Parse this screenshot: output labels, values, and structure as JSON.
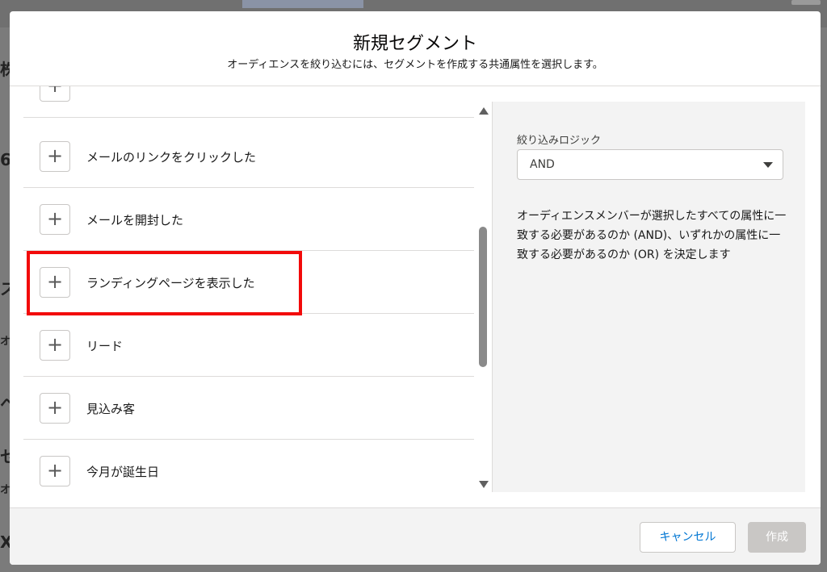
{
  "background": {
    "fragments": [
      "株",
      "6",
      "ス",
      "オ",
      "ヘ",
      "セ",
      "オ",
      "X"
    ]
  },
  "modal": {
    "title": "新規セグメント",
    "subtitle": "オーディエンスを絞り込むには、セグメントを作成する共通属性を選択します。"
  },
  "attribute_list": {
    "items": [
      {
        "label": "",
        "add_icon": "+"
      },
      {
        "label": "メールのリンクをクリックした",
        "add_icon": "+"
      },
      {
        "label": "メールを開封した",
        "add_icon": "+"
      },
      {
        "label": "ランディングページを表示した",
        "add_icon": "+"
      },
      {
        "label": "リード",
        "add_icon": "+"
      },
      {
        "label": "見込み客",
        "add_icon": "+"
      },
      {
        "label": "今月が誕生日",
        "add_icon": "+"
      }
    ]
  },
  "filter_logic": {
    "label": "絞り込みロジック",
    "selected": "AND",
    "description": "オーディエンスメンバーが選択したすべての属性に一致する必要があるのか (AND)、いずれかの属性に一致する必要があるのか (OR) を決定します"
  },
  "footer": {
    "cancel_label": "キャンセル",
    "create_label": "作成"
  },
  "colors": {
    "accent": "#0176d3",
    "highlight": "#f20a0a",
    "disabled_button": "#c9c7c5"
  }
}
